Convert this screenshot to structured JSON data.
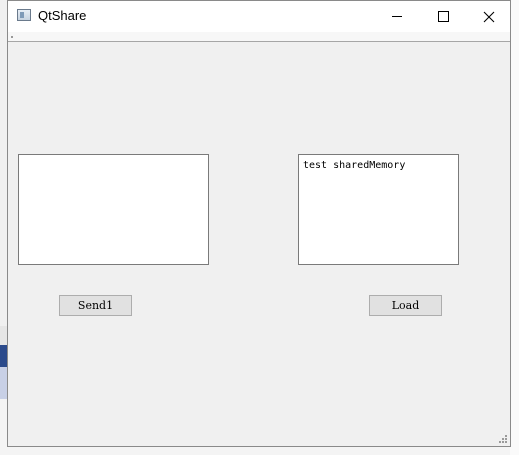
{
  "window": {
    "title": "QtShare",
    "icon": "app-window-icon",
    "controls": {
      "minimize_icon": "minimize-icon",
      "maximize_icon": "maximize-icon",
      "close_icon": "close-icon"
    }
  },
  "main": {
    "left_text": "",
    "right_text": "test sharedMemory",
    "send_button_label": "Send1",
    "load_button_label": "Load"
  },
  "colors": {
    "window_bg": "#f0f0f0",
    "titlebar_bg": "#ffffff",
    "button_bg": "#e1e1e1",
    "textbox_bg": "#ffffff"
  }
}
